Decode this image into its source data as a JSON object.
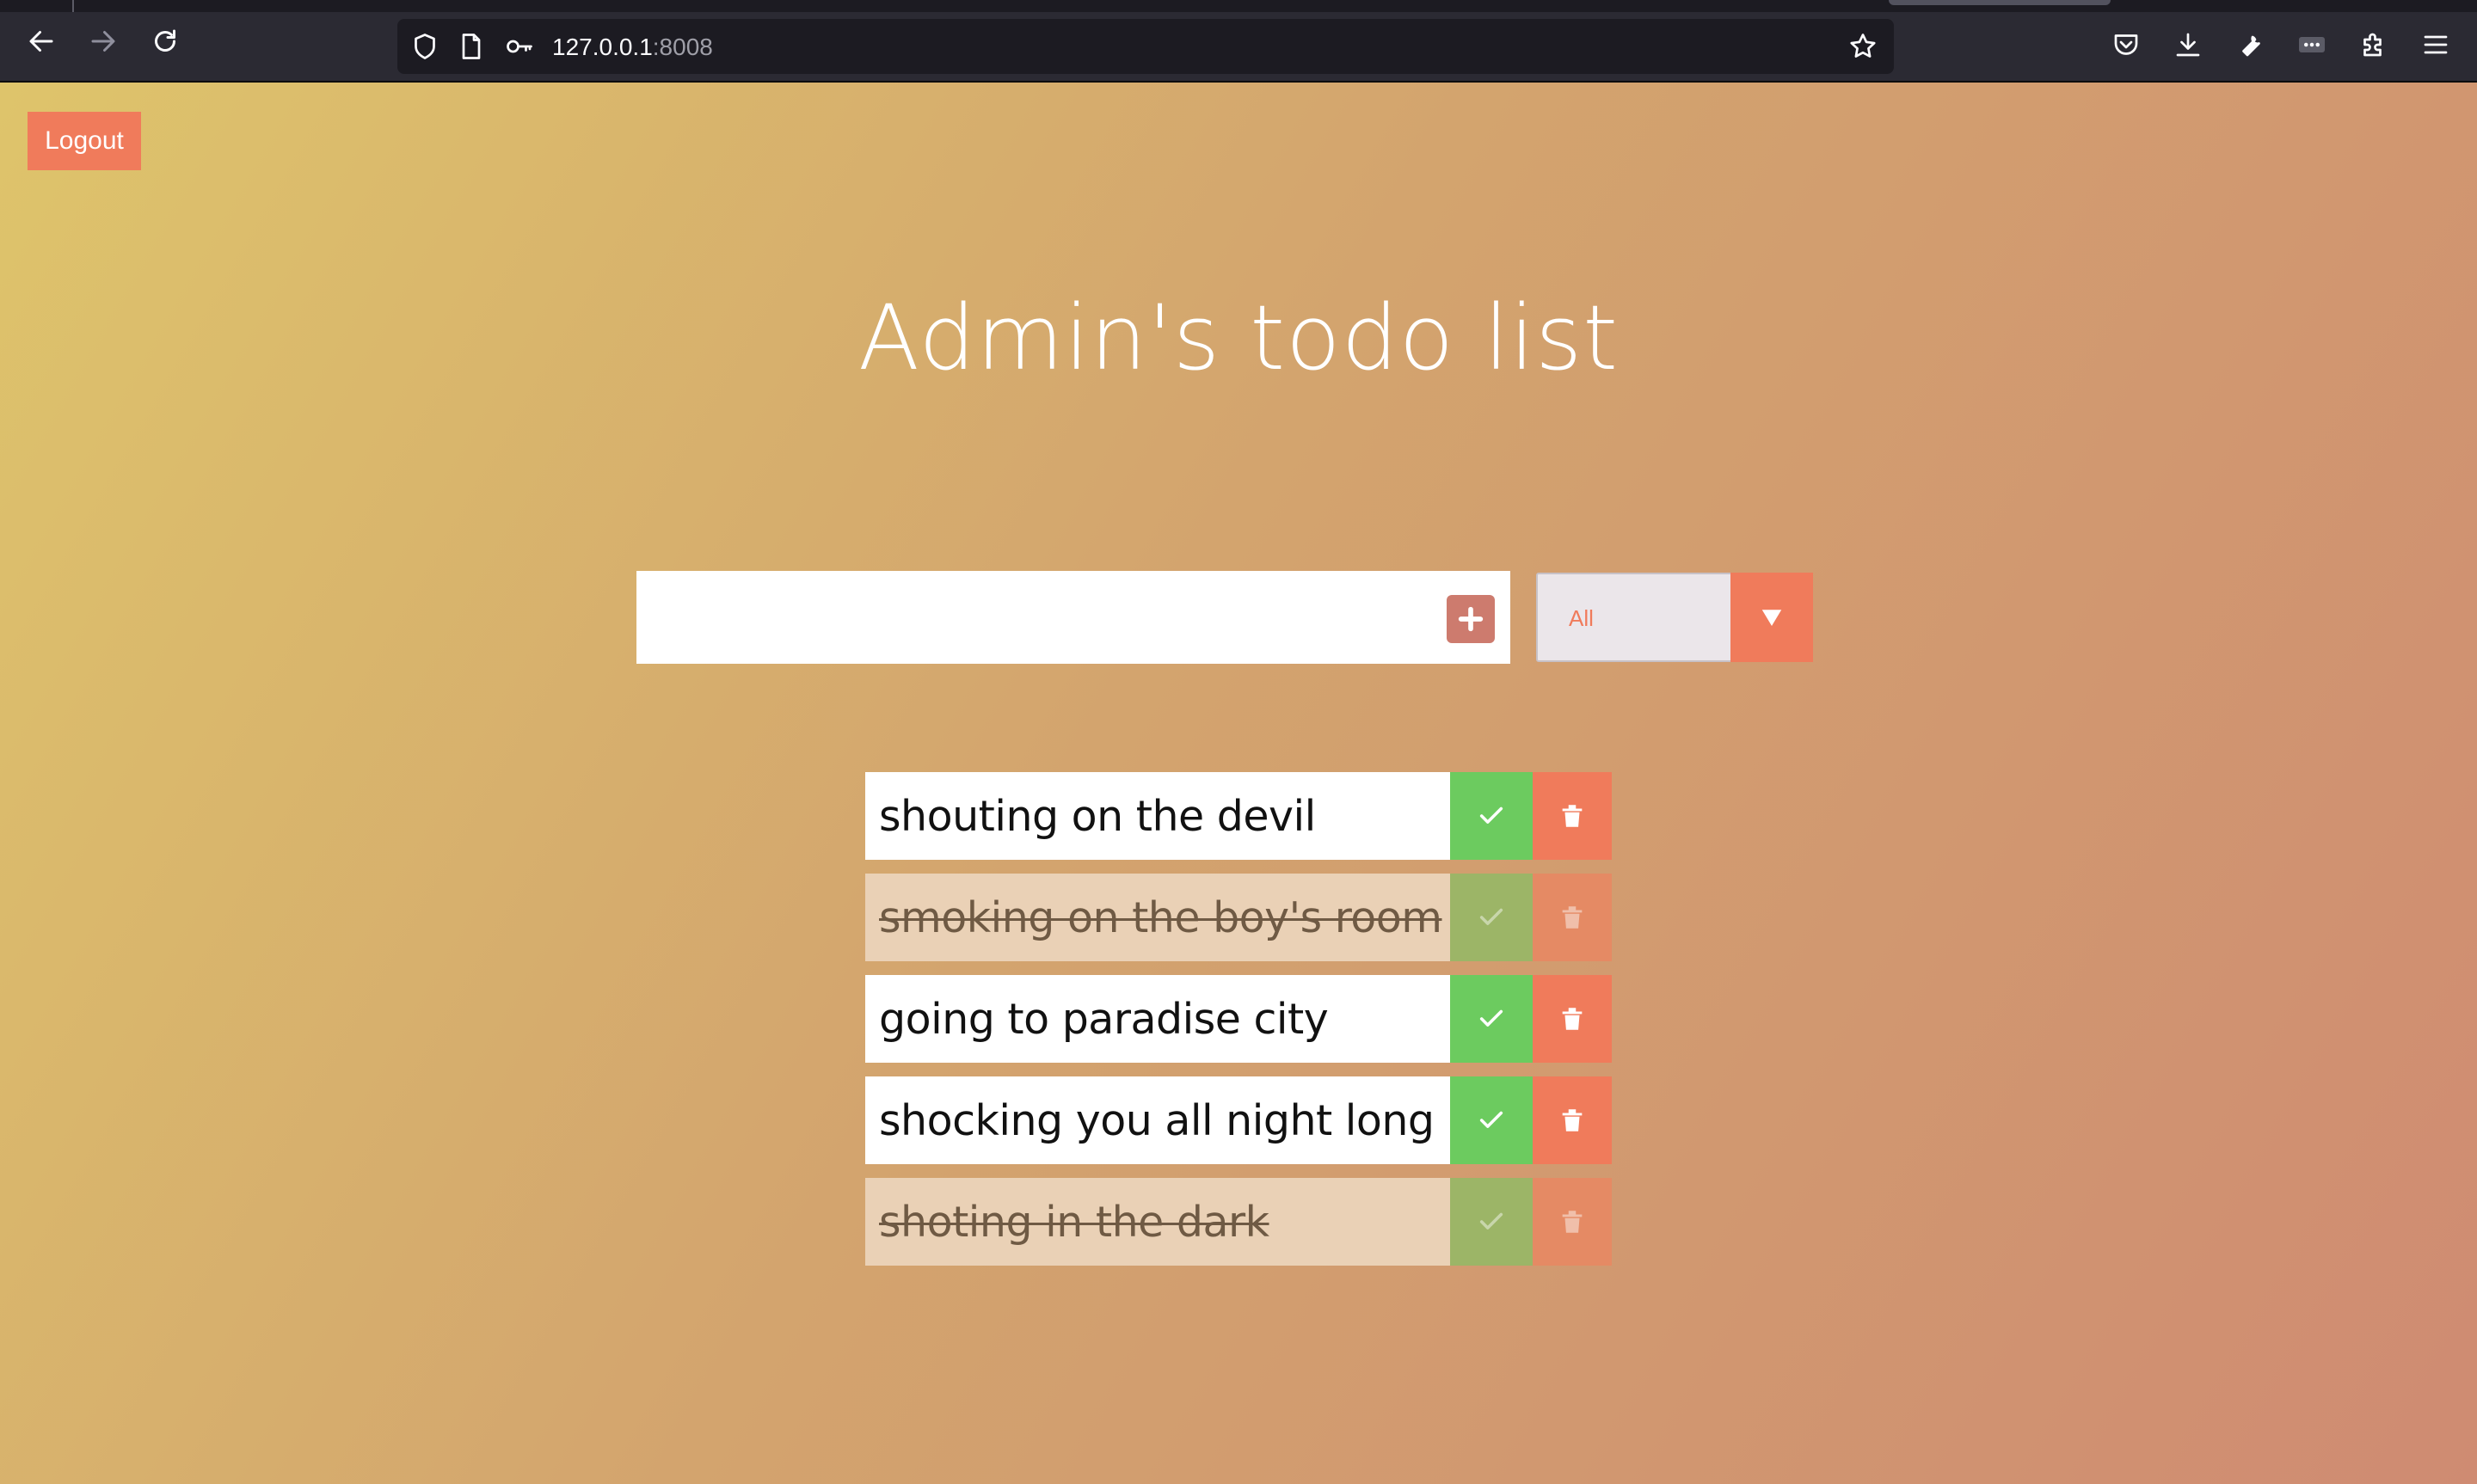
{
  "browser": {
    "url_host": "127.0.0.1",
    "url_port": ":8008",
    "icons": [
      "back-icon",
      "forward-icon",
      "reload-icon",
      "shield-icon",
      "page-icon",
      "key-icon",
      "star-icon",
      "pocket-icon",
      "download-icon",
      "wrench-icon",
      "extension-icon",
      "puzzle-icon",
      "menu-icon"
    ]
  },
  "header": {
    "logout_label": "Logout"
  },
  "main": {
    "title": "Admin's todo list",
    "input_value": "",
    "filter_selected": "All"
  },
  "todos": [
    {
      "text": "shouting on the devil",
      "completed": false
    },
    {
      "text": "smoking on the boy's room",
      "completed": true
    },
    {
      "text": "going to paradise city",
      "completed": false
    },
    {
      "text": "shocking you all night long",
      "completed": false
    },
    {
      "text": "shoting in the dark",
      "completed": true
    }
  ],
  "colors": {
    "accent": "#f07b5b",
    "complete_green": "#6ccb5f",
    "gradient_start": "#dec46b",
    "gradient_end": "#cf8b72"
  }
}
